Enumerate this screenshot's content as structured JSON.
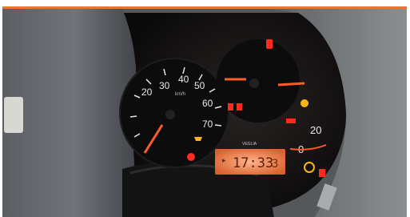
{
  "photo": {
    "accent_color": "#f0752c",
    "subject": "illuminated car instrument cluster behind steering wheel"
  },
  "speedometer": {
    "tick_labels": [
      "20",
      "30",
      "40",
      "50",
      "60",
      "70"
    ],
    "unit_label": "km/h"
  },
  "fuel_gauge": {
    "tick_labels": [
      "0",
      "20"
    ]
  },
  "lcd": {
    "time": "17:33",
    "side_value": "3"
  },
  "brand_text": "VEGLIA",
  "warning_lights": {
    "colors": {
      "red": "#ff2a1e",
      "amber": "#ffb21a",
      "needle": "#ff5a2a"
    },
    "icons": [
      "battery-warning-icon",
      "oil-warning-icon",
      "engine-check-icon",
      "brake-warning-icon",
      "seatbelt-icon",
      "door-open-icon",
      "turn-signal-icon"
    ]
  }
}
